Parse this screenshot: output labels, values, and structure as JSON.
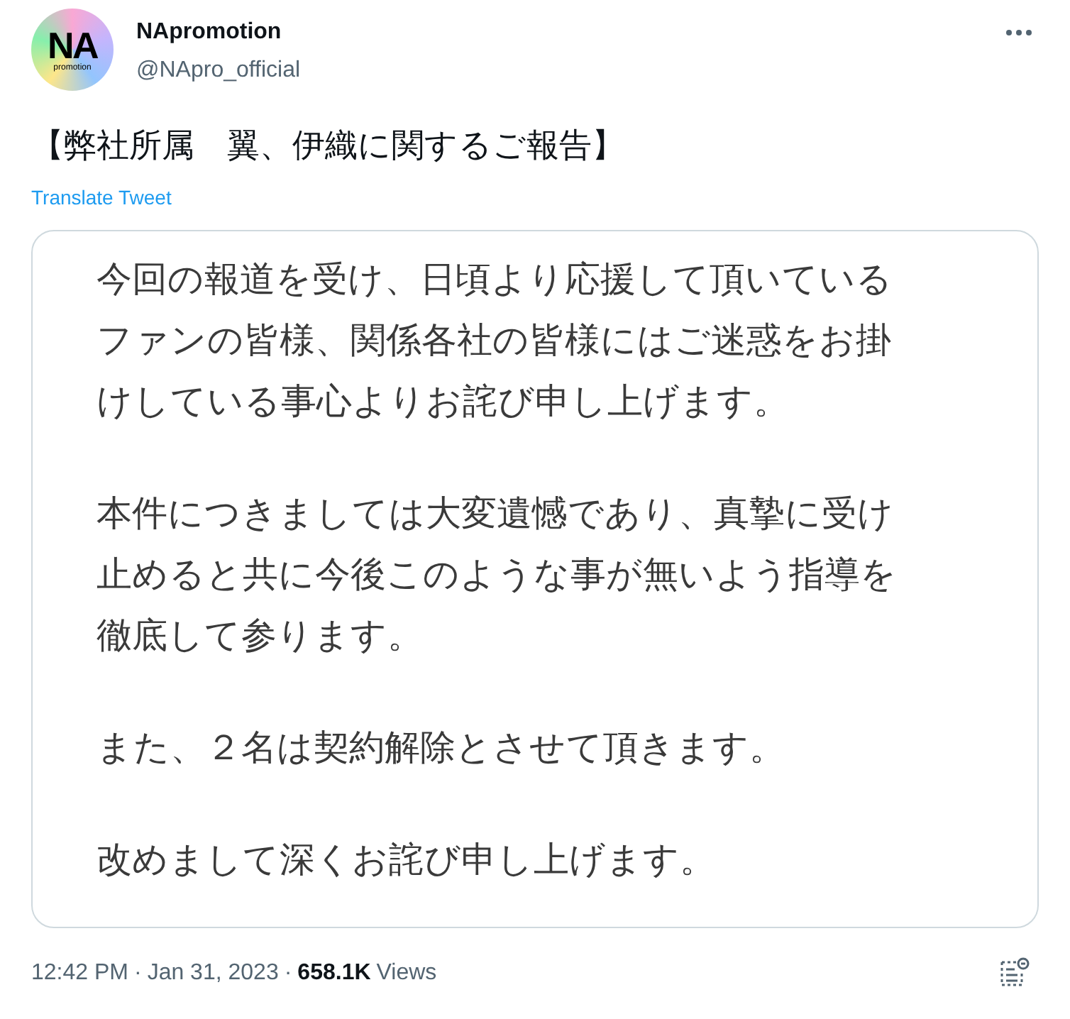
{
  "author": {
    "logo_text": "NA",
    "logo_subtext": "promotion",
    "name": "NApromotion",
    "handle": "@NApro_official"
  },
  "tweet": {
    "text": "【弊社所属　翼、伊織に関するご報告】",
    "translate": "Translate Tweet"
  },
  "image": {
    "paragraphs": [
      [
        "今回の報道を受け、日頃より応援して頂いている",
        "ファンの皆様、関係各社の皆様にはご迷惑をお掛",
        "けしている事心よりお詫び申し上げます。"
      ],
      [
        "本件につきましては大変遺憾であり、真摯に受け",
        "止めると共に今後このような事が無いよう指導を",
        "徹底して参ります。"
      ],
      [
        "また、２名は契約解除とさせて頂きます。"
      ],
      [
        "改めまして深くお詫び申し上げます。"
      ]
    ]
  },
  "meta": {
    "separator": "·",
    "time": "12:42 PM",
    "date": "Jan 31, 2023",
    "views_count": "658.1K",
    "views_label": "Views"
  }
}
